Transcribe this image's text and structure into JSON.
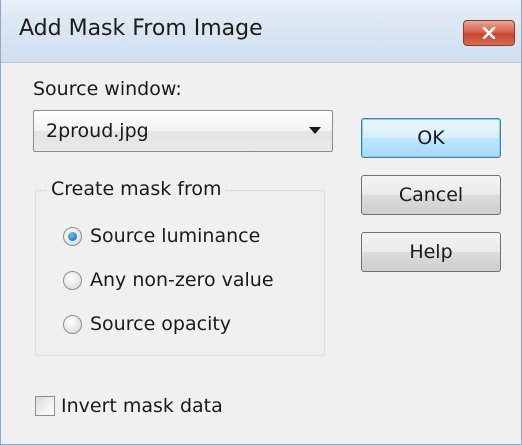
{
  "dialog": {
    "title": "Add Mask From Image",
    "close_icon": "close-x-icon",
    "close_color": "#c8462f"
  },
  "source": {
    "label": "Source window:",
    "selected": "2proud.jpg"
  },
  "group": {
    "legend": "Create mask from",
    "options": [
      {
        "label": "Source luminance",
        "checked": true
      },
      {
        "label": "Any non-zero value",
        "checked": false
      },
      {
        "label": "Source opacity",
        "checked": false
      }
    ]
  },
  "invert": {
    "label": "Invert mask data",
    "checked": false
  },
  "buttons": {
    "ok": "OK",
    "cancel": "Cancel",
    "help": "Help"
  }
}
